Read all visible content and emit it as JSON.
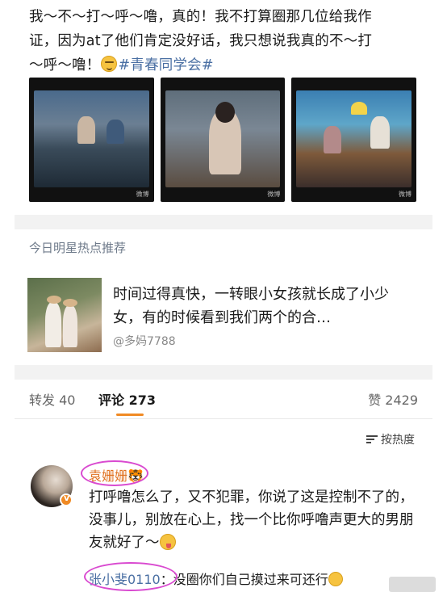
{
  "post": {
    "line1": "我～不～打～呼～噜，真的！我不打算圈那几位给我作",
    "line2": "证，因为at了他们肯定没好话，我只想说我真的不～打",
    "line3_prefix": "～呼～噜！",
    "topic": "#青春同学会#"
  },
  "images": [
    {
      "watermark": "微博"
    },
    {
      "watermark": "微博"
    },
    {
      "watermark": "微博"
    }
  ],
  "hot": {
    "header": "今日明星热点推荐",
    "text": "时间过得真快，一转眼小女孩就长成了小少女，有的时候看到我们两个的合…",
    "author": "@多妈7788"
  },
  "tabs": {
    "repost": "转发 40",
    "comment": "评论 273",
    "like": "赞 2429"
  },
  "sort_label": "按热度",
  "comment": {
    "username": "袁姗姗",
    "username_extra": "🐯",
    "text": "打呼噜怎么了，又不犯罪，你说了这是控制不了的，没事儿，别放在心上，找一个比你呼噜声更大的男朋友就好了～",
    "reply_user": "张小斐0110",
    "reply_text": "没圈你们自己摸过来可还行"
  },
  "colors": {
    "topic": "#4a6fa3",
    "username": "#e0701e",
    "tab_underline": "#f08a24",
    "highlight_circle": "#d94ad0"
  }
}
